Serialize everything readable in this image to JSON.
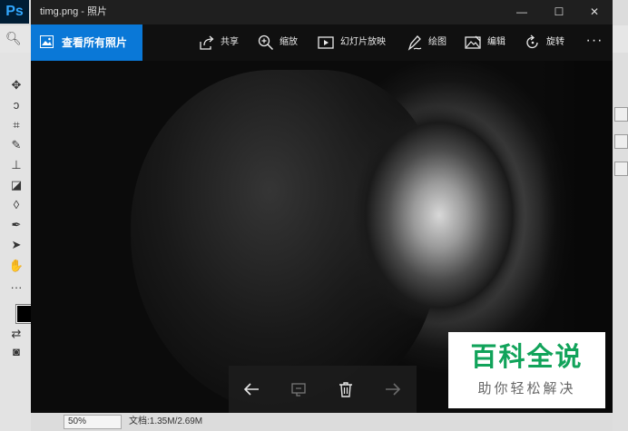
{
  "photoshop": {
    "logo": "Ps",
    "zoom": "50%",
    "doc_info": "文档:1.35M/2.69M",
    "foreground_color": "#000000"
  },
  "window": {
    "title": "timg.png - 照片",
    "controls": [
      "minimize-icon",
      "maximize-icon",
      "close-icon"
    ]
  },
  "appbar": {
    "all_photos_label": "查看所有照片",
    "commands": [
      {
        "icon": "share-icon",
        "label": "共享"
      },
      {
        "icon": "zoom-icon",
        "label": "缩放"
      },
      {
        "icon": "slideshow-icon",
        "label": "幻灯片放映"
      },
      {
        "icon": "draw-icon",
        "label": "绘图"
      },
      {
        "icon": "edit-icon",
        "label": "编辑"
      },
      {
        "icon": "rotate-icon",
        "label": "旋转"
      }
    ],
    "more": "···"
  },
  "nav": {
    "buttons": [
      "back-arrow-icon",
      "rotate-view-icon",
      "delete-icon",
      "forward-arrow-icon"
    ]
  },
  "watermark": {
    "main": "百科全说",
    "sub": "助你轻松解决"
  },
  "colors": {
    "accent": "#0a78d7",
    "watermark_green": "#11a35a"
  }
}
